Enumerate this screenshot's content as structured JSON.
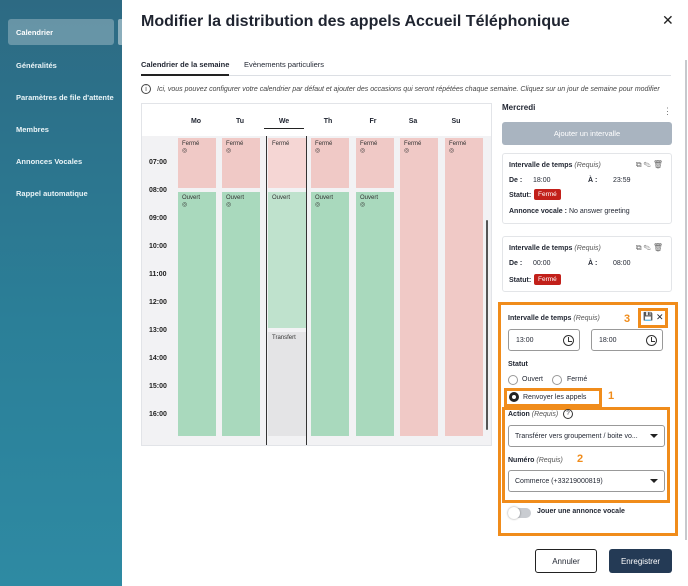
{
  "sidebar": {
    "items": [
      {
        "label": "Calendrier",
        "active": true
      },
      {
        "label": "Généralités"
      },
      {
        "label": "Paramètres de file d'attente"
      },
      {
        "label": "Membres"
      },
      {
        "label": "Annonces Vocales"
      },
      {
        "label": "Rappel automatique"
      }
    ]
  },
  "modal": {
    "title": "Modifier la distribution des appels Accueil Téléphonique",
    "close_glyph": "✕"
  },
  "tabs": [
    {
      "label": "Calendrier de la semaine",
      "active": true
    },
    {
      "label": "Evènements particuliers"
    }
  ],
  "info_text": "Ici, vous pouvez configurer votre calendrier par défaut et ajouter des occasions qui seront répétées chaque semaine. Cliquez sur un jour de semaine pour modifier",
  "calendar": {
    "days": [
      "Mo",
      "Tu",
      "We",
      "Th",
      "Fr",
      "Sa",
      "Su"
    ],
    "selected_day": "We",
    "hours": [
      "07:00",
      "08:00",
      "09:00",
      "10:00",
      "11:00",
      "12:00",
      "13:00",
      "14:00",
      "15:00",
      "16:00"
    ],
    "labels": {
      "closed": "Fermé",
      "open": "Ouvert",
      "transfer": "Transfert",
      "globe": "◎"
    }
  },
  "right": {
    "day_title": "Mercredi",
    "kebab": "⋮",
    "add_button": "Ajouter un intervalle",
    "required": "(Requis)",
    "interval_label": "Intervalle de temps",
    "from_label": "De :",
    "to_label": "À :",
    "status_label": "Statut:",
    "voice_label": "Annonce vocale :",
    "card1": {
      "from": "18:00",
      "to": "23:59",
      "status": "Fermé",
      "voice": "No answer greeting"
    },
    "card2": {
      "from": "00:00",
      "to": "08:00",
      "status": "Fermé"
    },
    "tool_icons": "⧉✎🗑"
  },
  "edit": {
    "interval_label": "Intervalle de temps",
    "required": "(Requis)",
    "from_value": "13:00",
    "to_value": "18:00",
    "status_title": "Statut",
    "radio_open": "Ouvert",
    "radio_closed": "Fermé",
    "radio_forward": "Renvoyer les appels",
    "action_label": "Action",
    "action_value": "Transférer vers groupement / boite vo...",
    "number_label": "Numéro",
    "number_value": "Commerce (+33219000819)",
    "voice_toggle_label": "Jouer une annonce vocale",
    "save_icon": "💾",
    "cancel_icon": "✕",
    "help_icon": "?",
    "marker_1": "1",
    "marker_2": "2",
    "marker_3": "3"
  },
  "footer": {
    "cancel": "Annuler",
    "save": "Enregistrer"
  },
  "colors": {
    "sidebar": "#2b7f98",
    "closed": "#f0c9c6",
    "open": "#a9d9bd",
    "badge": "#c2201a",
    "highlight": "#f08c1b",
    "save_button": "#243a55"
  }
}
